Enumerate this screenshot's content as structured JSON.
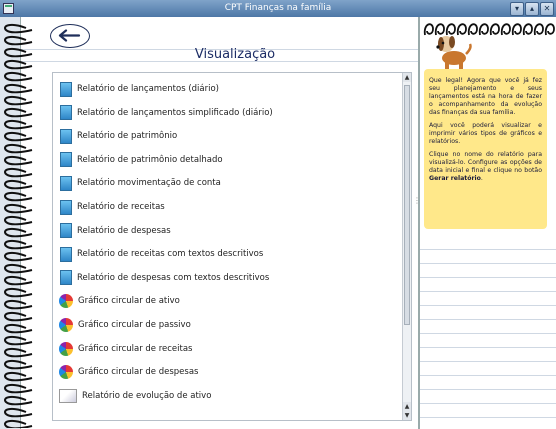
{
  "window": {
    "title": "CPT Finanças na família"
  },
  "page": {
    "title": "Visualização"
  },
  "reports": [
    {
      "label": "Relatório de lançamentos (diário)",
      "icon": "document-icon"
    },
    {
      "label": "Relatório de lançamentos simplificado (diário)",
      "icon": "document-icon"
    },
    {
      "label": "Relatório de patrimônio",
      "icon": "document-icon"
    },
    {
      "label": "Relatório de patrimônio detalhado",
      "icon": "document-icon"
    },
    {
      "label": "Relatório movimentação de conta",
      "icon": "document-icon"
    },
    {
      "label": "Relatório de receitas",
      "icon": "document-icon"
    },
    {
      "label": "Relatório de despesas",
      "icon": "document-icon"
    },
    {
      "label": "Relatório de receitas com textos descritivos",
      "icon": "document-icon"
    },
    {
      "label": "Relatório de despesas com textos descritivos",
      "icon": "document-icon"
    },
    {
      "label": "Gráfico circular de ativo",
      "icon": "pie-chart-icon"
    },
    {
      "label": "Gráfico circular de passivo",
      "icon": "pie-chart-icon"
    },
    {
      "label": "Gráfico circular de receitas",
      "icon": "pie-chart-icon"
    },
    {
      "label": "Gráfico circular de despesas",
      "icon": "pie-chart-icon"
    },
    {
      "label": "Relatório de evolução de ativo",
      "icon": "line-chart-icon"
    }
  ],
  "tip": {
    "p1": "Que legal! Agora que você já fez seu planejamento e seus lançamentos está na hora de fazer o acompanhamento da evolução das finanças da sua família.",
    "p2": "Aqui você poderá visualizar e imprimir vários tipos de gráficos e relatórios.",
    "p3_before": "Clique no nome do relatório para visualizá-lo. Configure as opções de data inicial e final e clique no botão ",
    "p3_bold": "Gerar relatório",
    "p3_after": "."
  },
  "colors": {
    "title_bar": "#5a82af",
    "tip_background": "#ffe88a",
    "page_title": "#1d2d66"
  }
}
